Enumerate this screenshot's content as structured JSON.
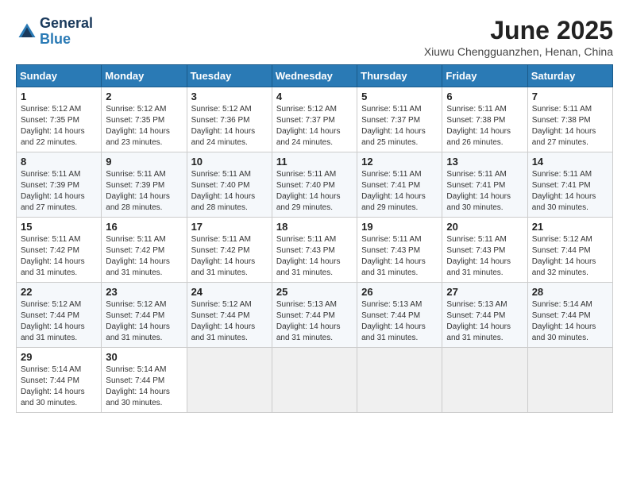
{
  "logo": {
    "line1": "General",
    "line2": "Blue"
  },
  "title": "June 2025",
  "subtitle": "Xiuwu Chengguanzhen, Henan, China",
  "headers": [
    "Sunday",
    "Monday",
    "Tuesday",
    "Wednesday",
    "Thursday",
    "Friday",
    "Saturday"
  ],
  "weeks": [
    [
      {
        "day": "1",
        "info": "Sunrise: 5:12 AM\nSunset: 7:35 PM\nDaylight: 14 hours\nand 22 minutes."
      },
      {
        "day": "2",
        "info": "Sunrise: 5:12 AM\nSunset: 7:35 PM\nDaylight: 14 hours\nand 23 minutes."
      },
      {
        "day": "3",
        "info": "Sunrise: 5:12 AM\nSunset: 7:36 PM\nDaylight: 14 hours\nand 24 minutes."
      },
      {
        "day": "4",
        "info": "Sunrise: 5:12 AM\nSunset: 7:37 PM\nDaylight: 14 hours\nand 24 minutes."
      },
      {
        "day": "5",
        "info": "Sunrise: 5:11 AM\nSunset: 7:37 PM\nDaylight: 14 hours\nand 25 minutes."
      },
      {
        "day": "6",
        "info": "Sunrise: 5:11 AM\nSunset: 7:38 PM\nDaylight: 14 hours\nand 26 minutes."
      },
      {
        "day": "7",
        "info": "Sunrise: 5:11 AM\nSunset: 7:38 PM\nDaylight: 14 hours\nand 27 minutes."
      }
    ],
    [
      {
        "day": "8",
        "info": "Sunrise: 5:11 AM\nSunset: 7:39 PM\nDaylight: 14 hours\nand 27 minutes."
      },
      {
        "day": "9",
        "info": "Sunrise: 5:11 AM\nSunset: 7:39 PM\nDaylight: 14 hours\nand 28 minutes."
      },
      {
        "day": "10",
        "info": "Sunrise: 5:11 AM\nSunset: 7:40 PM\nDaylight: 14 hours\nand 28 minutes."
      },
      {
        "day": "11",
        "info": "Sunrise: 5:11 AM\nSunset: 7:40 PM\nDaylight: 14 hours\nand 29 minutes."
      },
      {
        "day": "12",
        "info": "Sunrise: 5:11 AM\nSunset: 7:41 PM\nDaylight: 14 hours\nand 29 minutes."
      },
      {
        "day": "13",
        "info": "Sunrise: 5:11 AM\nSunset: 7:41 PM\nDaylight: 14 hours\nand 30 minutes."
      },
      {
        "day": "14",
        "info": "Sunrise: 5:11 AM\nSunset: 7:41 PM\nDaylight: 14 hours\nand 30 minutes."
      }
    ],
    [
      {
        "day": "15",
        "info": "Sunrise: 5:11 AM\nSunset: 7:42 PM\nDaylight: 14 hours\nand 31 minutes."
      },
      {
        "day": "16",
        "info": "Sunrise: 5:11 AM\nSunset: 7:42 PM\nDaylight: 14 hours\nand 31 minutes."
      },
      {
        "day": "17",
        "info": "Sunrise: 5:11 AM\nSunset: 7:42 PM\nDaylight: 14 hours\nand 31 minutes."
      },
      {
        "day": "18",
        "info": "Sunrise: 5:11 AM\nSunset: 7:43 PM\nDaylight: 14 hours\nand 31 minutes."
      },
      {
        "day": "19",
        "info": "Sunrise: 5:11 AM\nSunset: 7:43 PM\nDaylight: 14 hours\nand 31 minutes."
      },
      {
        "day": "20",
        "info": "Sunrise: 5:11 AM\nSunset: 7:43 PM\nDaylight: 14 hours\nand 31 minutes."
      },
      {
        "day": "21",
        "info": "Sunrise: 5:12 AM\nSunset: 7:44 PM\nDaylight: 14 hours\nand 32 minutes."
      }
    ],
    [
      {
        "day": "22",
        "info": "Sunrise: 5:12 AM\nSunset: 7:44 PM\nDaylight: 14 hours\nand 31 minutes."
      },
      {
        "day": "23",
        "info": "Sunrise: 5:12 AM\nSunset: 7:44 PM\nDaylight: 14 hours\nand 31 minutes."
      },
      {
        "day": "24",
        "info": "Sunrise: 5:12 AM\nSunset: 7:44 PM\nDaylight: 14 hours\nand 31 minutes."
      },
      {
        "day": "25",
        "info": "Sunrise: 5:13 AM\nSunset: 7:44 PM\nDaylight: 14 hours\nand 31 minutes."
      },
      {
        "day": "26",
        "info": "Sunrise: 5:13 AM\nSunset: 7:44 PM\nDaylight: 14 hours\nand 31 minutes."
      },
      {
        "day": "27",
        "info": "Sunrise: 5:13 AM\nSunset: 7:44 PM\nDaylight: 14 hours\nand 31 minutes."
      },
      {
        "day": "28",
        "info": "Sunrise: 5:14 AM\nSunset: 7:44 PM\nDaylight: 14 hours\nand 30 minutes."
      }
    ],
    [
      {
        "day": "29",
        "info": "Sunrise: 5:14 AM\nSunset: 7:44 PM\nDaylight: 14 hours\nand 30 minutes."
      },
      {
        "day": "30",
        "info": "Sunrise: 5:14 AM\nSunset: 7:44 PM\nDaylight: 14 hours\nand 30 minutes."
      },
      {
        "day": "",
        "info": ""
      },
      {
        "day": "",
        "info": ""
      },
      {
        "day": "",
        "info": ""
      },
      {
        "day": "",
        "info": ""
      },
      {
        "day": "",
        "info": ""
      }
    ]
  ]
}
